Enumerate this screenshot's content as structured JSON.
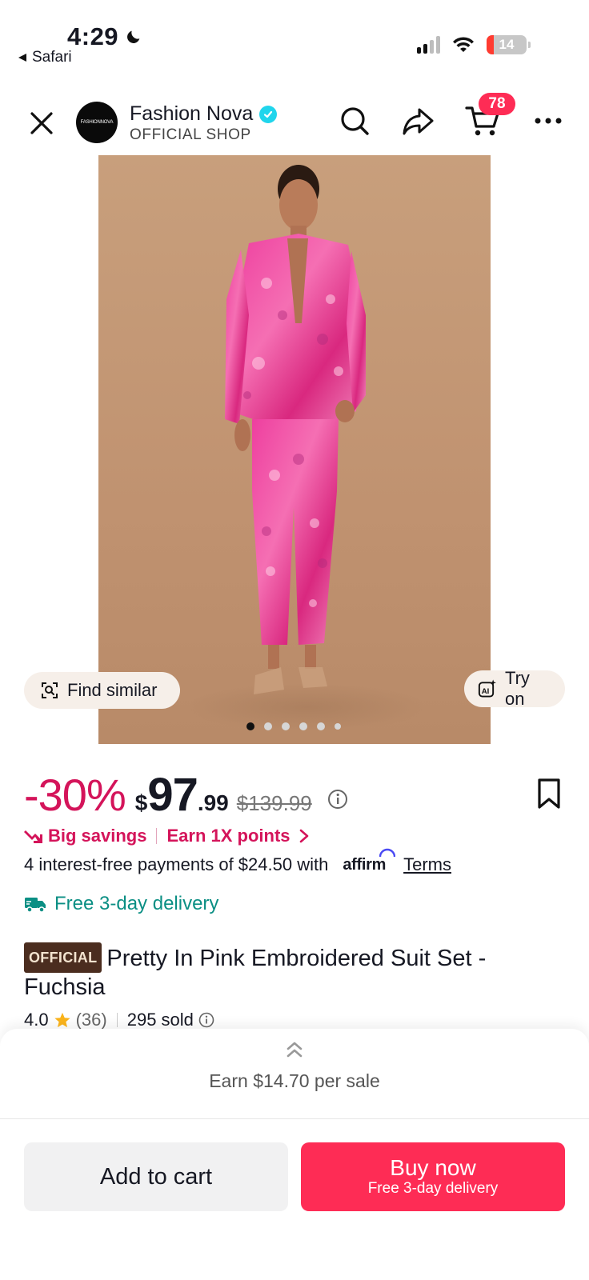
{
  "status_bar": {
    "time": "4:29",
    "back_app": "Safari",
    "battery": "14",
    "battery_level": 0.14
  },
  "header": {
    "shop_logo_text": "FASHIONNOVA",
    "shop_name": "Fashion Nova",
    "shop_sub": "OFFICIAL SHOP",
    "cart_count": "78",
    "icons": [
      "close-icon",
      "search-icon",
      "share-icon",
      "cart-icon",
      "more-icon"
    ]
  },
  "gallery": {
    "find_similar": "Find similar",
    "try_on": "Try on",
    "dot_count": 6,
    "active_dot": 0
  },
  "price": {
    "discount": "-30%",
    "currency": "$",
    "integer": "97",
    "decimal": ".99",
    "original": "$139.99"
  },
  "promos": {
    "savings": "Big savings",
    "points": "Earn 1X points",
    "installments": "4 interest-free payments of $24.50 with",
    "affirm": "affirm",
    "terms": "Terms",
    "delivery": "Free 3-day delivery"
  },
  "product": {
    "badge": "OFFICIAL",
    "title": "Pretty In Pink Embroidered Suit Set - Fuchsia",
    "rating": "4.0",
    "reviews": "(36)",
    "sold": "295 sold"
  },
  "bottom": {
    "earn": "Earn $14.70 per sale",
    "add_to_cart": "Add to cart",
    "buy_now": "Buy now",
    "buy_sub": "Free 3-day delivery"
  },
  "colors": {
    "accent": "#fe2c55",
    "discount": "#d4145a",
    "delivery": "#0b8f84",
    "verified": "#20d5ec",
    "official_badge": "#4b2d1f"
  }
}
